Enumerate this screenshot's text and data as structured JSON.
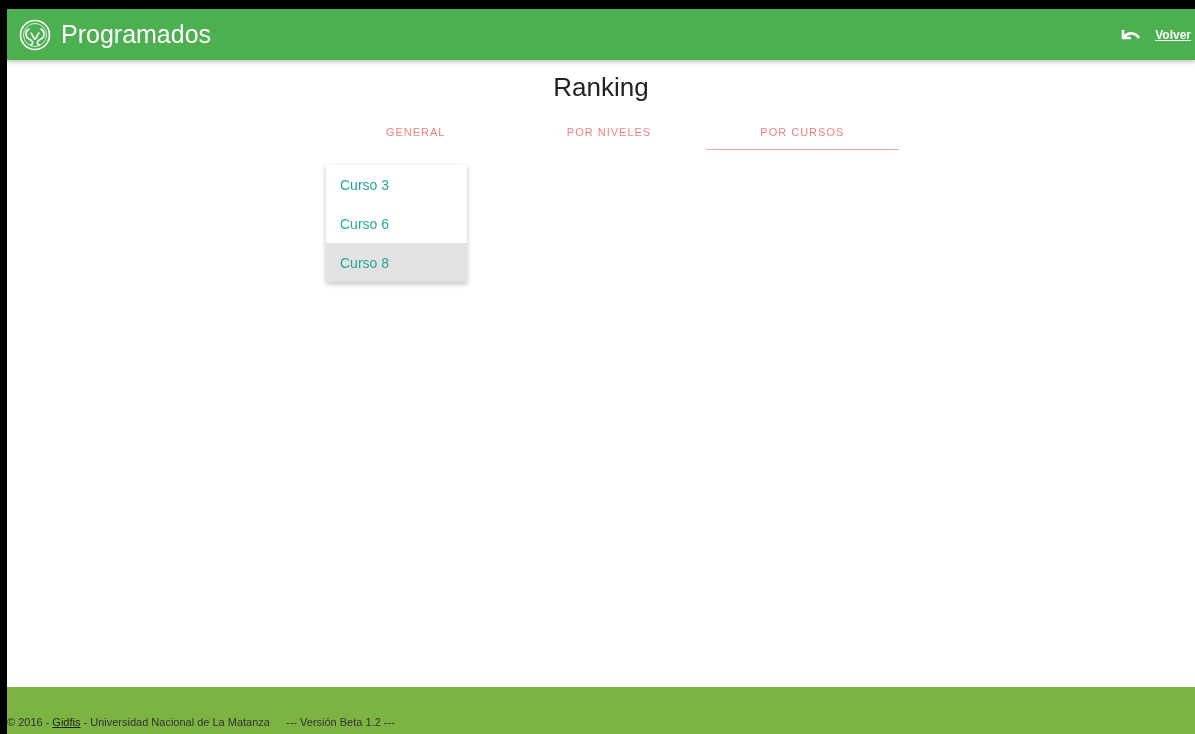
{
  "header": {
    "title": "Programados",
    "back_link": "Volver"
  },
  "page": {
    "title": "Ranking"
  },
  "tabs": [
    {
      "label": "GENERAL",
      "selected": false
    },
    {
      "label": "POR NIVELES",
      "selected": false
    },
    {
      "label": "POR CURSOS",
      "selected": true
    }
  ],
  "dropdown": {
    "items": [
      {
        "label": "Curso 3",
        "selected": false
      },
      {
        "label": "Curso 6",
        "selected": false
      },
      {
        "label": "Curso 8",
        "selected": true
      }
    ]
  },
  "footer": {
    "copyright": "© 2016 -",
    "link": "Gidfis",
    "institution": "- Universidad Nacional de La Matanza",
    "version": "--- Versión Beta 1.2 ---"
  }
}
